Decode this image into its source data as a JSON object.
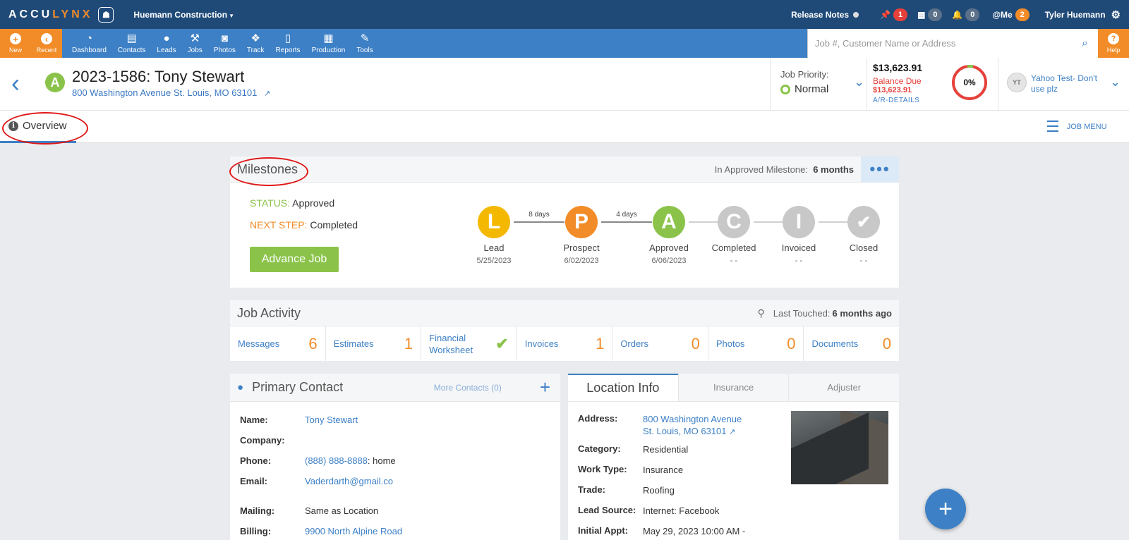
{
  "topbar": {
    "logo_part1": "ACCU",
    "logo_part2": "LYNX",
    "company": "Huemann Construction",
    "release_notes": "Release Notes",
    "pin_count": "1",
    "calendar_count": "0",
    "bell_count": "0",
    "me_label": "@Me",
    "me_count": "2",
    "user_name": "Tyler Huemann"
  },
  "nav": {
    "new": "New",
    "recent": "Recent",
    "items": [
      "Dashboard",
      "Contacts",
      "Leads",
      "Jobs",
      "Photos",
      "Track",
      "Reports",
      "Production",
      "Tools"
    ],
    "search_placeholder": "Job #, Customer Name or Address",
    "help": "Help"
  },
  "job": {
    "status_letter": "A",
    "title": "2023-1586: Tony Stewart",
    "address": "800 Washington Avenue St. Louis, MO 63101",
    "priority_label": "Job Priority:",
    "priority_value": "Normal",
    "total": "$13,623.91",
    "balance_label": "Balance Due",
    "balance_value": "$13,623.91",
    "ar_details": "A/R-DETAILS",
    "percent": "0%",
    "assignee_initials": "YT",
    "assignee_name": "Yahoo Test- Don't use plz"
  },
  "tabs": {
    "overview": "Overview",
    "job_menu": "JOB MENU"
  },
  "milestones": {
    "title": "Milestones",
    "meta_label": "In Approved Milestone:",
    "meta_value": "6 months",
    "status_label": "STATUS:",
    "status_value": "Approved",
    "next_label": "NEXT STEP:",
    "next_value": "Completed",
    "advance_label": "Advance Job",
    "steps": [
      {
        "letter": "L",
        "name": "Lead",
        "date": "5/25/2023",
        "color": "#f5b800"
      },
      {
        "letter": "P",
        "name": "Prospect",
        "date": "6/02/2023",
        "color": "#f28c28"
      },
      {
        "letter": "A",
        "name": "Approved",
        "date": "6/06/2023",
        "color": "#8bc34a"
      },
      {
        "letter": "C",
        "name": "Completed",
        "date": "- -",
        "color": "#c8c8c8"
      },
      {
        "letter": "I",
        "name": "Invoiced",
        "date": "- -",
        "color": "#c8c8c8"
      },
      {
        "letter": "✔",
        "name": "Closed",
        "date": "- -",
        "color": "#c8c8c8"
      }
    ],
    "gap1": "8 days",
    "gap2": "4 days"
  },
  "activity": {
    "title": "Job Activity",
    "touched_label": "Last Touched:",
    "touched_value": "6 months ago",
    "items": [
      {
        "label": "Messages",
        "value": "6"
      },
      {
        "label": "Estimates",
        "value": "1"
      },
      {
        "label": "Financial Worksheet",
        "value": ""
      },
      {
        "label": "Invoices",
        "value": "1"
      },
      {
        "label": "Orders",
        "value": "0"
      },
      {
        "label": "Photos",
        "value": "0"
      },
      {
        "label": "Documents",
        "value": "0"
      }
    ]
  },
  "contact": {
    "title": "Primary Contact",
    "more": "More Contacts (0)",
    "name_k": "Name:",
    "name_v": "Tony Stewart",
    "company_k": "Company:",
    "phone_k": "Phone:",
    "phone_v": "(888) 888-8888",
    "phone_type": " : home",
    "email_k": "Email:",
    "email_v": "Vaderdarth@gmail.co",
    "mailing_k": "Mailing:",
    "mailing_v": "Same as Location",
    "billing_k": "Billing:",
    "billing_v": "9900 North Alpine Road"
  },
  "location": {
    "tab1": "Location Info",
    "tab2": "Insurance",
    "tab3": "Adjuster",
    "address_k": "Address:",
    "address_v1": "800 Washington Avenue",
    "address_v2": "St. Louis, MO 63101",
    "category_k": "Category:",
    "category_v": "Residential",
    "worktype_k": "Work Type:",
    "worktype_v": "Insurance",
    "trade_k": "Trade:",
    "trade_v": "Roofing",
    "source_k": "Lead Source:",
    "source_v": "Internet: Facebook",
    "appt_k": "Initial Appt:",
    "appt_v": "May 29, 2023 10:00 AM -"
  }
}
